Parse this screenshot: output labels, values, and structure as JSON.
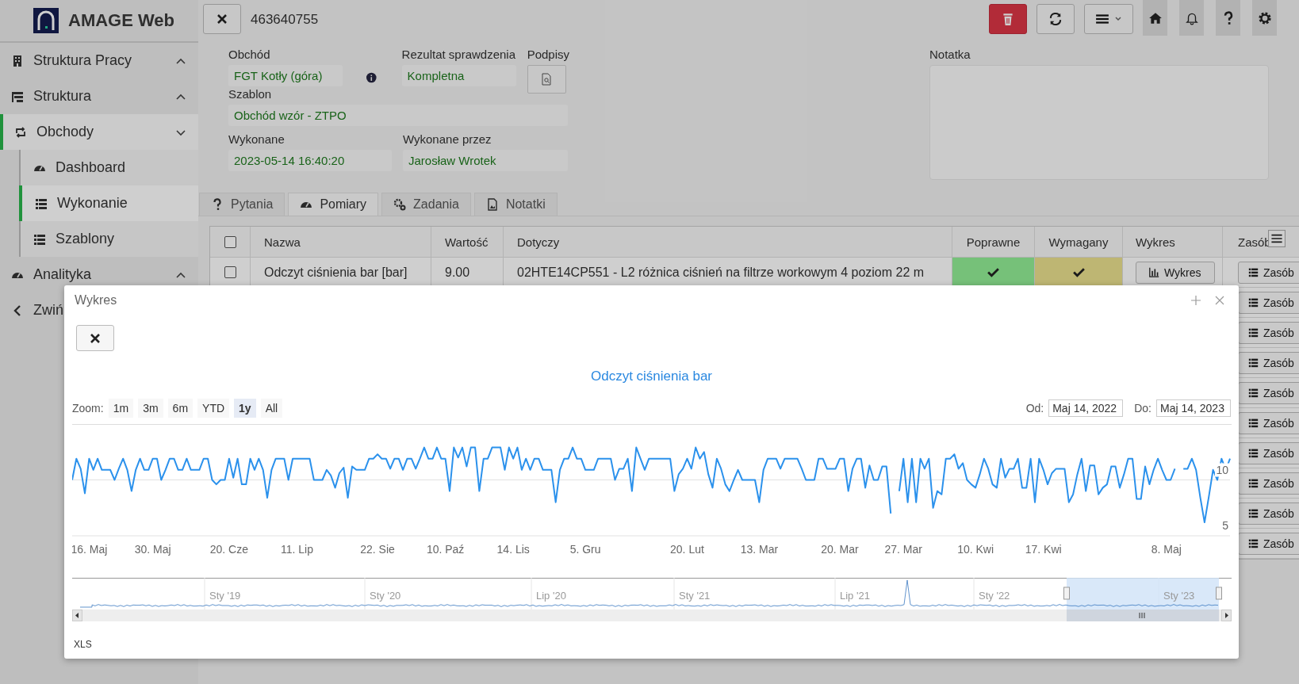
{
  "app": {
    "name": "AMAGE Web"
  },
  "sidebar": {
    "items": [
      {
        "label": "Struktura Pracy",
        "expanded": false,
        "selected": false
      },
      {
        "label": "Struktura",
        "expanded": false,
        "selected": false
      },
      {
        "label": "Obchody",
        "expanded": true,
        "selected": true,
        "children": [
          {
            "label": "Dashboard",
            "selected": false
          },
          {
            "label": "Wykonanie",
            "selected": true
          },
          {
            "label": "Szablony",
            "selected": false
          }
        ]
      },
      {
        "label": "Analityka",
        "expanded": false,
        "selected": false
      }
    ],
    "collapse": "Zwiń"
  },
  "header": {
    "record_id": "463640755"
  },
  "form": {
    "round": {
      "label": "Obchód",
      "value": "FGT Kotły (góra)"
    },
    "result": {
      "label": "Rezultat sprawdzenia",
      "value": "Kompletna"
    },
    "signatures": {
      "label": "Podpisy"
    },
    "template": {
      "label": "Szablon",
      "value": "Obchód wzór - ZTPO"
    },
    "done": {
      "label": "Wykonane",
      "value": "2023-05-14 16:40:20"
    },
    "done_by": {
      "label": "Wykonane przez",
      "value": "Jarosław Wrotek"
    },
    "note": {
      "label": "Notatka"
    }
  },
  "tabs": [
    {
      "label": "Pytania",
      "selected": false
    },
    {
      "label": "Pomiary",
      "selected": true
    },
    {
      "label": "Zadania",
      "selected": false
    },
    {
      "label": "Notatki",
      "selected": false
    }
  ],
  "table": {
    "columns": [
      "Nazwa",
      "Wartość",
      "Dotyczy",
      "Poprawne",
      "Wymagany",
      "Wykres",
      "Zasób"
    ],
    "header_checked": false,
    "rows": [
      {
        "checked": false,
        "name": "Odczyt ciśnienia bar [bar]",
        "value": "9.00",
        "relates": "02HTE14CP551 - L2 różnica ciśnień na filtrze workowym 4 poziom 22 m",
        "correct": true,
        "required": true,
        "chart_button": "Wykres",
        "resource_button": "Zasób"
      },
      {
        "resource_button": "Zasób"
      },
      {
        "resource_button": "Zasób"
      },
      {
        "resource_button": "Zasób"
      },
      {
        "resource_button": "Zasób"
      },
      {
        "resource_button": "Zasób"
      },
      {
        "resource_button": "Zasób"
      },
      {
        "resource_button": "Zasób"
      },
      {
        "resource_button": "Zasób"
      },
      {
        "resource_button": "Zasób"
      }
    ]
  },
  "dialog": {
    "title": "Wykres",
    "zoom_label": "Zoom:",
    "zoom_buttons": [
      {
        "label": "1m",
        "selected": false
      },
      {
        "label": "3m",
        "selected": false
      },
      {
        "label": "6m",
        "selected": false
      },
      {
        "label": "YTD",
        "selected": false
      },
      {
        "label": "1y",
        "selected": true
      },
      {
        "label": "All",
        "selected": false
      }
    ],
    "from": {
      "label": "Od:",
      "value": "Maj 14, 2022"
    },
    "to": {
      "label": "Do:",
      "value": "Maj 14, 2023"
    },
    "chart": {
      "title": "Odczyt ciśnienia bar",
      "y_labels": [
        "10",
        "5"
      ],
      "x_labels": [
        "16. Maj",
        "30. Maj",
        "20. Cze",
        "11. Lip",
        "22. Sie",
        "10. Paź",
        "14. Lis",
        "5. Gru",
        "20. Lut",
        "13. Mar",
        "20. Mar",
        "27. Mar",
        "10. Kwi",
        "17. Kwi",
        "8. Maj"
      ]
    },
    "navigator_labels": [
      "Sty '19",
      "Sty '20",
      "Lip '20",
      "Sty '21",
      "Lip '21",
      "Sty '22",
      "Sty '23"
    ],
    "export": "XLS"
  }
}
